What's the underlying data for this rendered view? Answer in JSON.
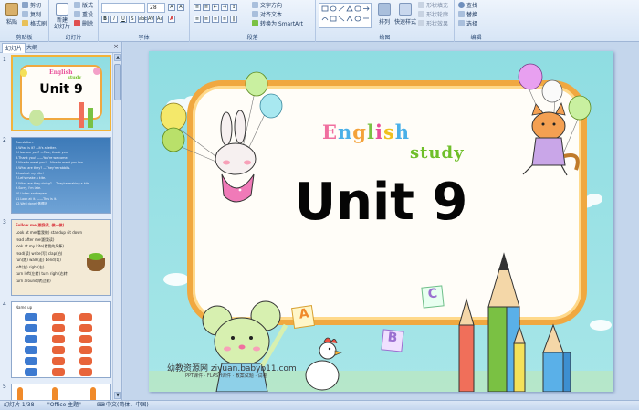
{
  "ribbon": {
    "clipboard": {
      "label": "剪贴板",
      "paste": "粘贴",
      "cut": "剪切",
      "copy": "复制",
      "format_painter": "格式刷"
    },
    "slides": {
      "label": "幻灯片",
      "new_slide": "新建\n幻灯片",
      "layout": "版式",
      "reset": "重设",
      "delete": "删除"
    },
    "font": {
      "label": "字体",
      "font_name": "",
      "font_size": "28"
    },
    "paragraph": {
      "label": "段落",
      "text_direction": "文字方向",
      "align_text": "对齐文本",
      "smartart": "转换为 SmartArt"
    },
    "drawing": {
      "label": "绘图",
      "arrange": "排列",
      "quick_styles": "快速样式",
      "shape_fill": "形状填充",
      "shape_outline": "形状轮廓",
      "shape_effects": "形状效果"
    },
    "editing": {
      "label": "编辑",
      "find": "查找",
      "replace": "替换",
      "select": "选择"
    }
  },
  "panel": {
    "tab_slides": "幻灯片",
    "tab_outline": "大纲",
    "close": "×",
    "thumb1_title": "Unit 9",
    "thumb1_eng": "English",
    "thumb1_study": "study",
    "thumb2_lines": [
      "Translation:",
      "1.What is it? —It's a letter.",
      "2.How are you? —Fine, thank you.",
      "3.Thank you! ——You're welcome.",
      "4.Nice to meet you! —Nice to meet you too.",
      "5.What are they? —They're rabbits.",
      "6.Look at my kite!",
      "7.Let's make a kite.",
      "8.What are they doing? —They're making a kite.",
      "9.Sorry, I'm late.",
      "10.Listen and repeat.",
      "11.Look at it. ——This is it.",
      "12.Well done! 做得好"
    ],
    "thumb3_title": "Follow me(跟我读, 做一做)",
    "thumb3_lines": [
      "Look at me(看我做) standup  sit down",
      "read after me(跟我读)",
      "look at my kite(看我的风筝)",
      "read(读)  write(写)    clap(拍)",
      "run(跑)   walk(走)   bend(弯)",
      "left(左)   right(右)",
      "turn left(左转)  turn right(右转)",
      "turn around(转过来)"
    ],
    "thumb4_title": "Name up"
  },
  "slide": {
    "title": "Unit 9",
    "english": "English",
    "study": "study",
    "english_letters": [
      "E",
      "n",
      "g",
      "l",
      "i",
      "s",
      "h"
    ],
    "english_colors": [
      "#f06f9f",
      "#4ab0e8",
      "#f4a23a",
      "#7ac143",
      "#e84f9a",
      "#f0c020",
      "#4ab0e8"
    ],
    "cube_letters": [
      "A",
      "B",
      "C"
    ],
    "watermark": "幼教资源网 ziyuan.babyb11.com",
    "watermark_sub": "PPT课件 · FLASH课件 · 教案试题 · 试卷"
  },
  "status": {
    "slide_info": "幻灯片 1/38",
    "theme": "\"Office 主题\"",
    "language": "中文(简体，中国)"
  },
  "colors": {
    "frame": "#f0a840",
    "sky": "#9de2e6",
    "title": "#050505",
    "selection": "#f2b33a"
  }
}
